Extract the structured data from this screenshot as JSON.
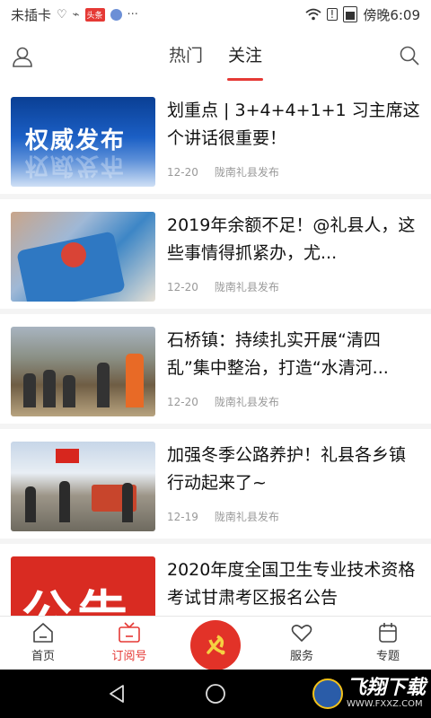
{
  "status_bar": {
    "carrier": "未插卡",
    "icon_names": [
      "heart-rate-icon",
      "usb-icon",
      "news-app-icon",
      "music-app-icon",
      "more-icon"
    ],
    "news_badge": "头条",
    "time": "傍晚6:09"
  },
  "top_nav": {
    "tabs": [
      {
        "label": "热门",
        "active": false
      },
      {
        "label": "关注",
        "active": true
      }
    ]
  },
  "feed": {
    "items": [
      {
        "title": "划重点 | 3+4+4+1+1 习主席这个讲话很重要！",
        "date": "12-20",
        "source": "陇南礼县发布",
        "thumb_text": "权威发布"
      },
      {
        "title": "2019年余额不足！@礼县人，这些事情得抓紧办，尤...",
        "date": "12-20",
        "source": "陇南礼县发布",
        "thumb_text": ""
      },
      {
        "title": "石桥镇：持续扎实开展“清四乱”集中整治，打造“水清河...",
        "date": "12-20",
        "source": "陇南礼县发布",
        "thumb_text": ""
      },
      {
        "title": "加强冬季公路养护！礼县各乡镇行动起来了~",
        "date": "12-19",
        "source": "陇南礼县发布",
        "thumb_text": ""
      },
      {
        "title": "2020年度全国卫生专业技术资格考试甘肃考区报名公告",
        "date": "",
        "source": "",
        "thumb_text": "公告"
      }
    ]
  },
  "bottom_nav": {
    "items": [
      {
        "label": "首页",
        "icon": "home-icon",
        "active": false
      },
      {
        "label": "订阅号",
        "icon": "tv-icon",
        "active": true
      },
      {
        "label": "",
        "icon": "party-emblem-icon",
        "active": false
      },
      {
        "label": "服务",
        "icon": "heart-icon",
        "active": false
      },
      {
        "label": "专题",
        "icon": "calendar-icon",
        "active": false
      }
    ]
  },
  "watermark": {
    "name": "飞翔下载",
    "url": "WWW.FXXZ.COM"
  },
  "colors": {
    "accent": "#e53935",
    "party_red": "#e23228"
  }
}
